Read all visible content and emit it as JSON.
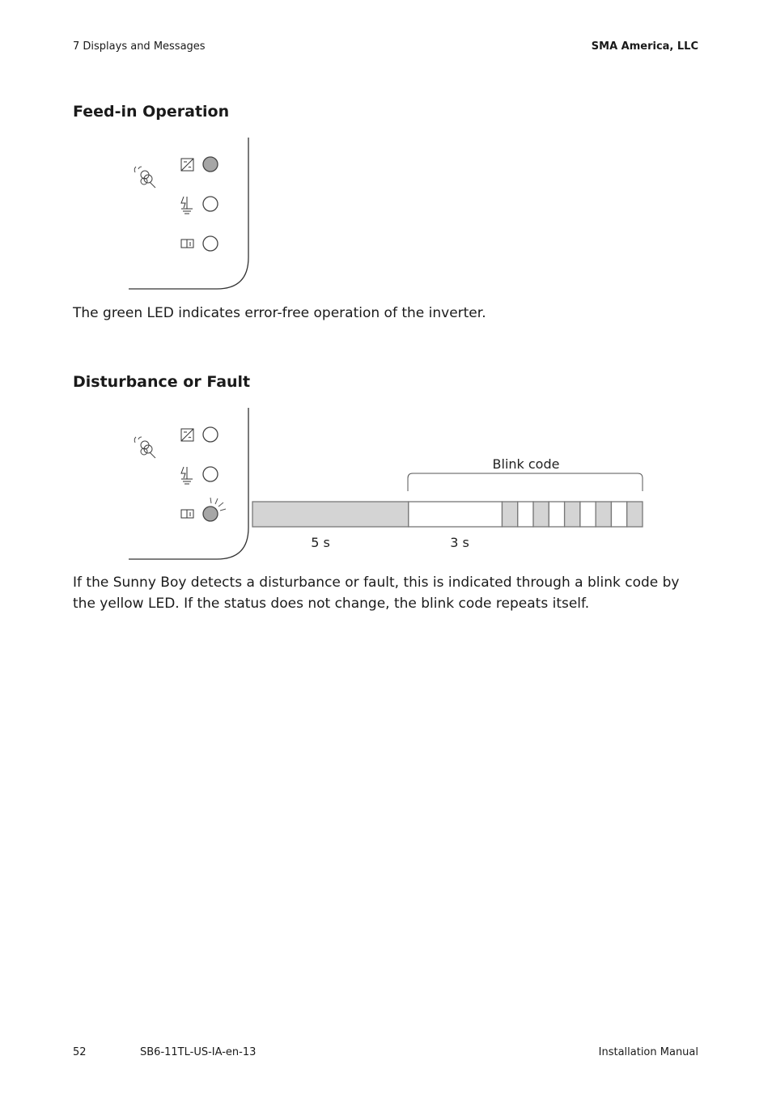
{
  "header": {
    "section": "7  Displays and Messages",
    "company": "SMA America, LLC"
  },
  "sections": [
    {
      "title": "Feed-in Operation",
      "leds": [
        {
          "symbol": "inverter-icon",
          "state": "on"
        },
        {
          "symbol": "ground-fault-icon",
          "state": "off"
        },
        {
          "symbol": "manual-info-icon",
          "state": "off"
        }
      ],
      "text": "The green LED indicates error-free operation of the inverter."
    },
    {
      "title": "Disturbance or Fault",
      "leds": [
        {
          "symbol": "inverter-icon",
          "state": "off"
        },
        {
          "symbol": "ground-fault-icon",
          "state": "off"
        },
        {
          "symbol": "manual-info-icon",
          "state": "blinking"
        }
      ],
      "text": "If the Sunny Boy detects a disturbance or fault, this is indicated through a blink code by the yellow LED. If the status does not change, the blink code repeats itself."
    }
  ],
  "timeline": {
    "bracket_label": "Blink code",
    "labels": [
      "5 s",
      "3 s"
    ],
    "segments": [
      {
        "duration": 5,
        "state": "on"
      },
      {
        "duration": 3,
        "state": "off"
      },
      {
        "duration": 0.5,
        "state": "on"
      },
      {
        "duration": 0.5,
        "state": "off"
      },
      {
        "duration": 0.5,
        "state": "on"
      },
      {
        "duration": 0.5,
        "state": "off"
      },
      {
        "duration": 0.5,
        "state": "on"
      },
      {
        "duration": 0.5,
        "state": "off"
      },
      {
        "duration": 0.5,
        "state": "on"
      },
      {
        "duration": 0.5,
        "state": "off"
      },
      {
        "duration": 0.5,
        "state": "on"
      }
    ]
  },
  "footer": {
    "page": "52",
    "doc_id": "SB6-11TL-US-IA-en-13",
    "doc_type": "Installation Manual"
  },
  "colors": {
    "led_on": "#a6a6a6",
    "segment_on": "#d4d4d4",
    "line": "#777777"
  }
}
